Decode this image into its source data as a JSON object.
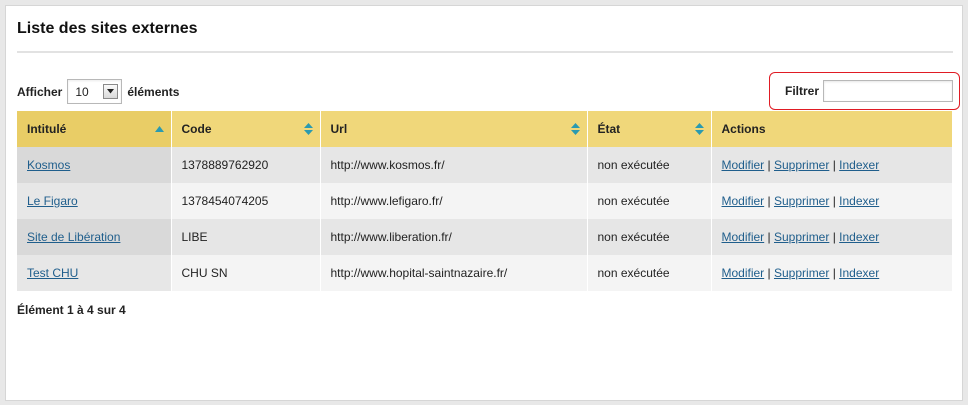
{
  "page": {
    "title": "Liste des sites externes"
  },
  "length": {
    "prefix": "Afficher",
    "value": "10",
    "suffix": "éléments"
  },
  "filter": {
    "label": "Filtrer",
    "value": ""
  },
  "table": {
    "columns": [
      "Intitulé",
      "Code",
      "Url",
      "État",
      "Actions"
    ],
    "rows": [
      {
        "intitule": "Kosmos",
        "code": "1378889762920",
        "url": "http://www.kosmos.fr/",
        "etat": "non exécutée"
      },
      {
        "intitule": "Le Figaro",
        "code": "1378454074205",
        "url": "http://www.lefigaro.fr/",
        "etat": "non exécutée"
      },
      {
        "intitule": "Site de Libération",
        "code": "LIBE",
        "url": "http://www.liberation.fr/",
        "etat": "non exécutée"
      },
      {
        "intitule": "Test CHU",
        "code": "CHU SN",
        "url": "http://www.hopital-saintnazaire.fr/",
        "etat": "non exécutée"
      }
    ],
    "actions": {
      "modify": "Modifier",
      "delete": "Supprimer",
      "index": "Indexer",
      "separator": "|"
    }
  },
  "info": "Élément 1 à 4 sur 4",
  "colors": {
    "header": "#f0d77a",
    "link": "#1f5e8c",
    "highlight": "#e01b24",
    "sort_icon": "#2a9ab0"
  }
}
